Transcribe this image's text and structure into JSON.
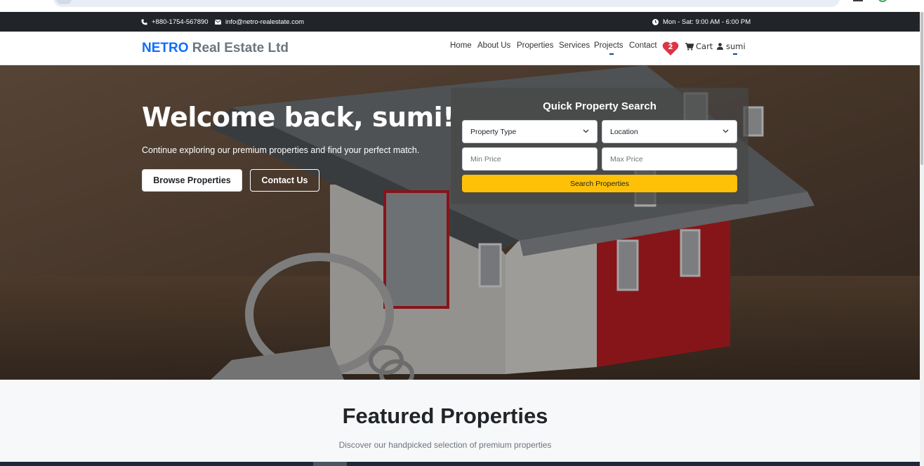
{
  "topbar": {
    "phone": "+880-1754-567890",
    "email": "info@netro-realestate.com",
    "hours": "Mon - Sat: 9:00 AM - 6:00 PM",
    "icons": [
      "phone-icon",
      "envelope-icon",
      "clock-icon"
    ]
  },
  "navbar": {
    "brand_primary": "NETRO",
    "brand_secondary": "Real Estate Ltd",
    "links": [
      "Home",
      "About Us",
      "Properties",
      "Services",
      "Projects",
      "Contact"
    ],
    "favorites_count": "2",
    "cart_label": "Cart",
    "user_label": "sumi"
  },
  "hero": {
    "title": "Welcome back, sumi!",
    "subtitle": "Continue exploring our premium properties and find your perfect match.",
    "browse_button": "Browse Properties",
    "contact_button": "Contact Us"
  },
  "search": {
    "title": "Quick Property Search",
    "property_type": "Property Type",
    "location": "Location",
    "min_price_placeholder": "Min Price",
    "max_price_placeholder": "Max Price",
    "submit": "Search Properties"
  },
  "featured": {
    "title": "Featured Properties",
    "subtitle": "Discover our handpicked selection of premium properties"
  },
  "colors": {
    "brand_blue": "#0d6efd",
    "brand_gray": "#6c757d",
    "topbar_bg": "#212529",
    "search_button": "#ffc107",
    "favorites_heart": "#dc3545"
  }
}
